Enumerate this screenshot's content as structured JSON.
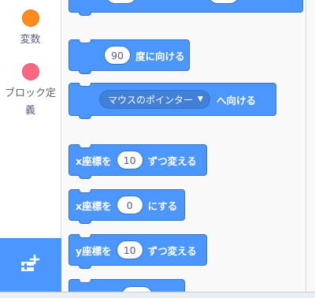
{
  "categories": [
    {
      "label": "変数",
      "color": "#ff8c1a",
      "icon": "variables-dot"
    },
    {
      "label": "ブロック定義",
      "color": "#ff6680",
      "icon": "my-blocks-dot"
    }
  ],
  "extension_button": {
    "icon": "add-extension-icon"
  },
  "blocks": {
    "point_in_direction": {
      "value": "90",
      "suffix": "度に向ける"
    },
    "point_towards": {
      "menu_value": "マウスのポインター",
      "suffix": "へ向ける"
    },
    "change_x_by": {
      "prefix": "x座標を",
      "value": "10",
      "suffix": "ずつ変える"
    },
    "set_x_to": {
      "prefix": "x座標を",
      "value": "0",
      "suffix": "にする"
    },
    "change_y_by": {
      "prefix": "y座標を",
      "value": "10",
      "suffix": "ずつ変える"
    }
  },
  "colors": {
    "motion_block": "#4c97ff",
    "motion_border": "#3373cc",
    "sidebar_text": "#575e75"
  }
}
